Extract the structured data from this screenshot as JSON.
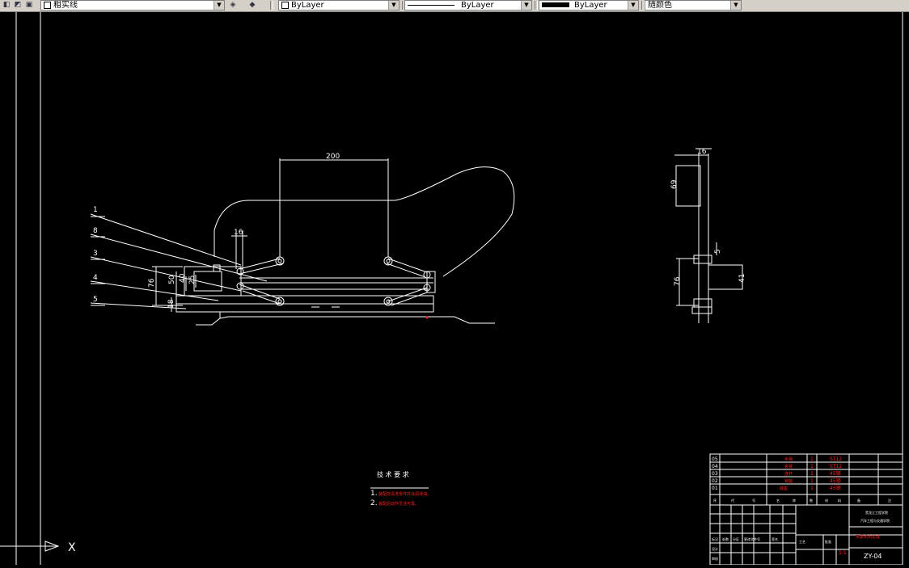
{
  "toolbar": {
    "linetype_name": "粗实线",
    "layer_color_value": "ByLayer",
    "layer_linetype_value": "ByLayer",
    "layer_lineweight_value": "ByLayer",
    "plot_style_value": "随颜色"
  },
  "drawing": {
    "main_view": {
      "dimensions": {
        "top_span": "200",
        "pin_height": "16",
        "overall_height": "76",
        "inner_height": "50",
        "bore": "40",
        "small": "25",
        "left_offset": "18"
      },
      "balloons": [
        "1",
        "8",
        "3",
        "4",
        "5"
      ]
    },
    "side_view": {
      "dimensions": {
        "top_width": "16",
        "upper_height": "69",
        "pin": "5",
        "overall_height": "76",
        "clamp_height": "41"
      }
    },
    "tech_req": {
      "title": "技 术 要 求",
      "items": [
        {
          "num": "1.",
          "text": "装配前清洗零件并涂润滑油。"
        },
        {
          "num": "2.",
          "text": "装配后动作灵活可靠。"
        }
      ]
    },
    "parts_list": {
      "rows": [
        {
          "no": "05",
          "name": "手柄",
          "qty": "1",
          "mat": "ST12"
        },
        {
          "no": "04",
          "name": "夹臂",
          "qty": "1",
          "mat": "ST12"
        },
        {
          "no": "03",
          "name": "连杆",
          "qty": "1",
          "mat": "45钢"
        },
        {
          "no": "02",
          "name": "销轴",
          "qty": "1",
          "mat": "45钢"
        },
        {
          "no": "01",
          "name": "底座",
          "qty": "1",
          "mat": "45钢"
        }
      ],
      "header": [
        "序",
        "代",
        "号",
        "名",
        "称",
        "数",
        "材",
        "料",
        "备",
        "注"
      ]
    },
    "title_block": {
      "school_line1": "黑龙江工程学院",
      "school_line2": "汽车工程与交通学院",
      "title": "夹紧机构总成",
      "drawing_no": "ZY-04",
      "labels": [
        "标记",
        "处数",
        "分区",
        "更改文件号",
        "签名",
        "设计",
        "审核",
        "工艺",
        "批准"
      ],
      "scale": "1:1"
    },
    "ucs_label": "X"
  },
  "colors": {
    "line": "#ffffff",
    "accent_text": "#ff2020",
    "toolbar_bg": "#d4d0c8"
  }
}
